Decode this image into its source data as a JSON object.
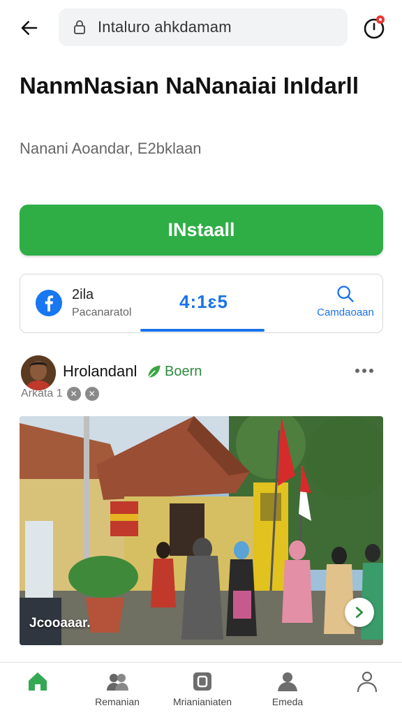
{
  "topbar": {
    "url": "Intaluro ahkdamam",
    "back_icon": "arrow-left-icon",
    "lock_icon": "lock-icon",
    "alarm_icon": "alarm-clock-icon",
    "notification_color": "#e53935"
  },
  "app": {
    "title": "NanmNasian NaNanaiai InIdarll",
    "subtitle": "Nanani Aoandar, E2bklaan",
    "install_label": "INstaall",
    "install_color": "#2fae46"
  },
  "info_card": {
    "icon": "facebook-icon",
    "name": "2ila",
    "sub": "Pacanaratol",
    "time": "4:1ɛ5",
    "search_label": "Camdaoaan",
    "accent_color": "#1a73e8"
  },
  "post": {
    "author": "Hrolandanl",
    "badge_label": "Boern",
    "badge_icon": "leaf-icon",
    "meta_label": "Arkata 1",
    "more_icon": "more-horizontal-icon",
    "caption": "Jcooaaar.",
    "next_icon": "chevron-right-icon"
  },
  "bottom_nav": {
    "items": [
      {
        "label": "",
        "icon": "home-icon",
        "active": true
      },
      {
        "label": "Remanian",
        "icon": "people-icon"
      },
      {
        "label": "Mrianianiaten",
        "icon": "app-box-icon"
      },
      {
        "label": "Emeda",
        "icon": "person-icon"
      },
      {
        "label": "",
        "icon": "profile-outline-icon"
      }
    ]
  }
}
